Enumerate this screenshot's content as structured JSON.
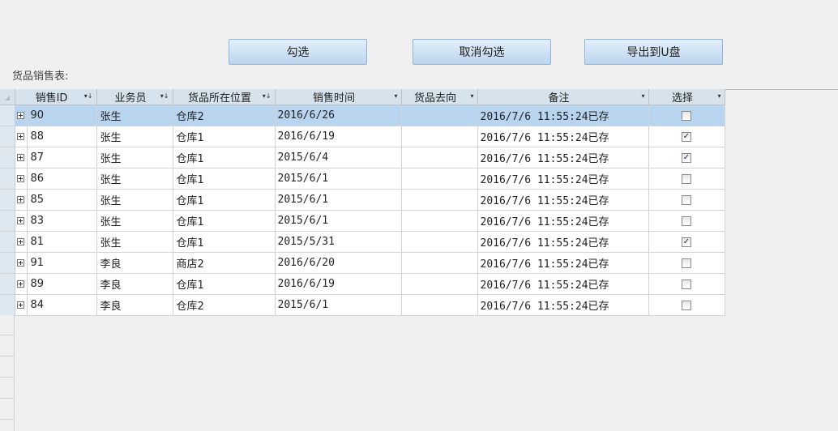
{
  "toolbar": {
    "check_label": "勾选",
    "uncheck_label": "取消勾选",
    "export_label": "导出到U盘"
  },
  "form": {
    "label": "货品销售表:"
  },
  "grid": {
    "columns": [
      {
        "label": "销售ID",
        "sort": "filter"
      },
      {
        "label": "业务员",
        "sort": "filter"
      },
      {
        "label": "货品所在位置",
        "sort": "filter"
      },
      {
        "label": "销售时间",
        "sort": "dropdown"
      },
      {
        "label": "货品去向",
        "sort": "dropdown"
      },
      {
        "label": "备注",
        "sort": "dropdown"
      },
      {
        "label": "选择",
        "sort": "dropdown"
      }
    ],
    "rows": [
      {
        "id": "90",
        "salesperson": "张生",
        "location": "仓库2",
        "date": "2016/6/26",
        "destination": "",
        "note": "2016/7/6 11:55:24已存",
        "checked": false
      },
      {
        "id": "88",
        "salesperson": "张生",
        "location": "仓库1",
        "date": "2016/6/19",
        "destination": "",
        "note": "2016/7/6 11:55:24已存",
        "checked": true
      },
      {
        "id": "87",
        "salesperson": "张生",
        "location": "仓库1",
        "date": "2015/6/4",
        "destination": "",
        "note": "2016/7/6 11:55:24已存",
        "checked": true
      },
      {
        "id": "86",
        "salesperson": "张生",
        "location": "仓库1",
        "date": "2015/6/1",
        "destination": "",
        "note": "2016/7/6 11:55:24已存",
        "checked": false
      },
      {
        "id": "85",
        "salesperson": "张生",
        "location": "仓库1",
        "date": "2015/6/1",
        "destination": "",
        "note": "2016/7/6 11:55:24已存",
        "checked": false
      },
      {
        "id": "83",
        "salesperson": "张生",
        "location": "仓库1",
        "date": "2015/6/1",
        "destination": "",
        "note": "2016/7/6 11:55:24已存",
        "checked": false
      },
      {
        "id": "81",
        "salesperson": "张生",
        "location": "仓库1",
        "date": "2015/5/31",
        "destination": "",
        "note": "2016/7/6 11:55:24已存",
        "checked": true
      },
      {
        "id": "91",
        "salesperson": "李良",
        "location": "商店2",
        "date": "2016/6/20",
        "destination": "",
        "note": "2016/7/6 11:55:24已存",
        "checked": false
      },
      {
        "id": "89",
        "salesperson": "李良",
        "location": "仓库1",
        "date": "2016/6/19",
        "destination": "",
        "note": "2016/7/6 11:55:24已存",
        "checked": false
      },
      {
        "id": "84",
        "salesperson": "李良",
        "location": "仓库2",
        "date": "2015/6/1",
        "destination": "",
        "note": "2016/7/6 11:55:24已存",
        "checked": false
      }
    ],
    "current_row": 0
  },
  "colors": {
    "header_bg": "#d6e3ec",
    "current_row_bg": "#b8d4ee",
    "button_top": "#e3effb",
    "button_bottom": "#bcd5ee"
  }
}
